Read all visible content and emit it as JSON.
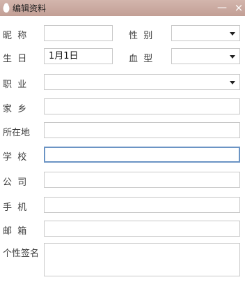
{
  "window": {
    "title": "编辑资料",
    "minimize_glyph": "—",
    "close_glyph": "×"
  },
  "form": {
    "nickname": {
      "label": "昵  称",
      "value": ""
    },
    "gender": {
      "label": "性  别",
      "value": ""
    },
    "birthday": {
      "label": "生  日",
      "value": "1月1日"
    },
    "blood_type": {
      "label": "血  型",
      "value": ""
    },
    "occupation": {
      "label": "职  业",
      "value": ""
    },
    "hometown": {
      "label": "家  乡",
      "value": ""
    },
    "location": {
      "label": "所在地",
      "value": ""
    },
    "school": {
      "label": "学  校",
      "value": ""
    },
    "company": {
      "label": "公  司",
      "value": ""
    },
    "phone": {
      "label": "手  机",
      "value": ""
    },
    "email": {
      "label": "邮  箱",
      "value": ""
    },
    "signature": {
      "label": "个性签名",
      "value": ""
    }
  },
  "colors": {
    "titlebar": "#c9aaa0",
    "focus_border": "#6b94c4"
  }
}
